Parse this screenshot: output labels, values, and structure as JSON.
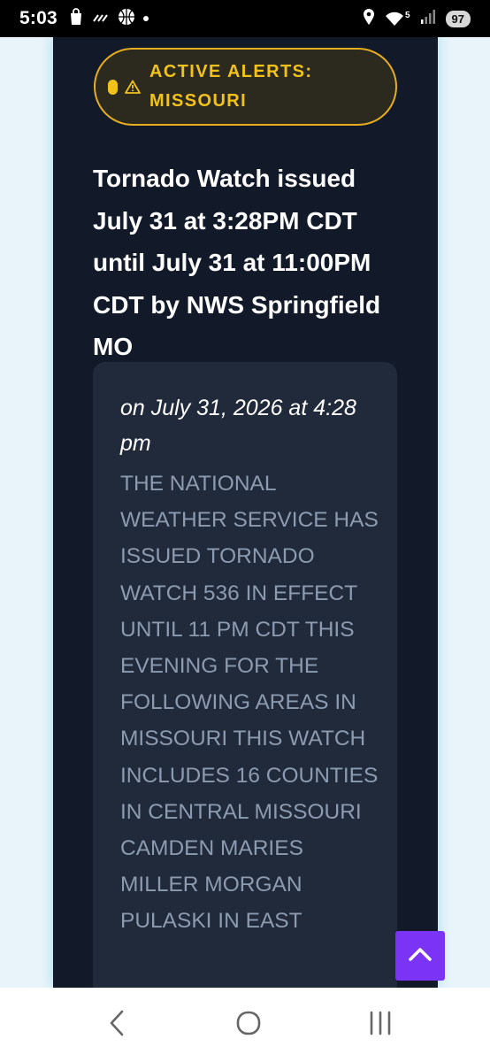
{
  "status_bar": {
    "time": "5:03",
    "left_icons": [
      "shopping-bag-icon",
      "sim-icon",
      "basketball-icon",
      "notification-dot-icon"
    ],
    "right_icons": [
      "location-icon",
      "wifi-icon",
      "signal-icon"
    ],
    "wifi_label": "5",
    "battery": "97"
  },
  "alert_banner": {
    "text": "ACTIVE ALERTS: MISSOURI",
    "icons": [
      "status-dot-icon",
      "warning-triangle-icon"
    ],
    "color": "#f2c21b"
  },
  "headline": "Tornado Watch issued July 31 at 3:28PM CDT until July 31 at 11:00PM CDT by NWS Springfield MO",
  "card": {
    "date": "on July 31, 2026 at 4:28 pm",
    "body": "THE NATIONAL WEATHER SERVICE HAS ISSUED TORNADO WATCH 536 IN EFFECT UNTIL 11 PM CDT THIS EVENING FOR THE FOLLOWING AREAS IN MISSOURI THIS WATCH INCLUDES 16 COUNTIES IN CENTRAL MISSOURI CAMDEN MARIES MILLER MORGAN PULASKI IN EAST"
  },
  "scroll_top": {
    "icon": "chevron-up-icon",
    "color": "#7b34f5"
  },
  "nav_bar": {
    "icons": [
      "back-icon",
      "home-icon",
      "recents-icon"
    ]
  },
  "colors": {
    "panel": "#121a29",
    "card": "#202a3b",
    "accent": "#e7ae1f"
  }
}
